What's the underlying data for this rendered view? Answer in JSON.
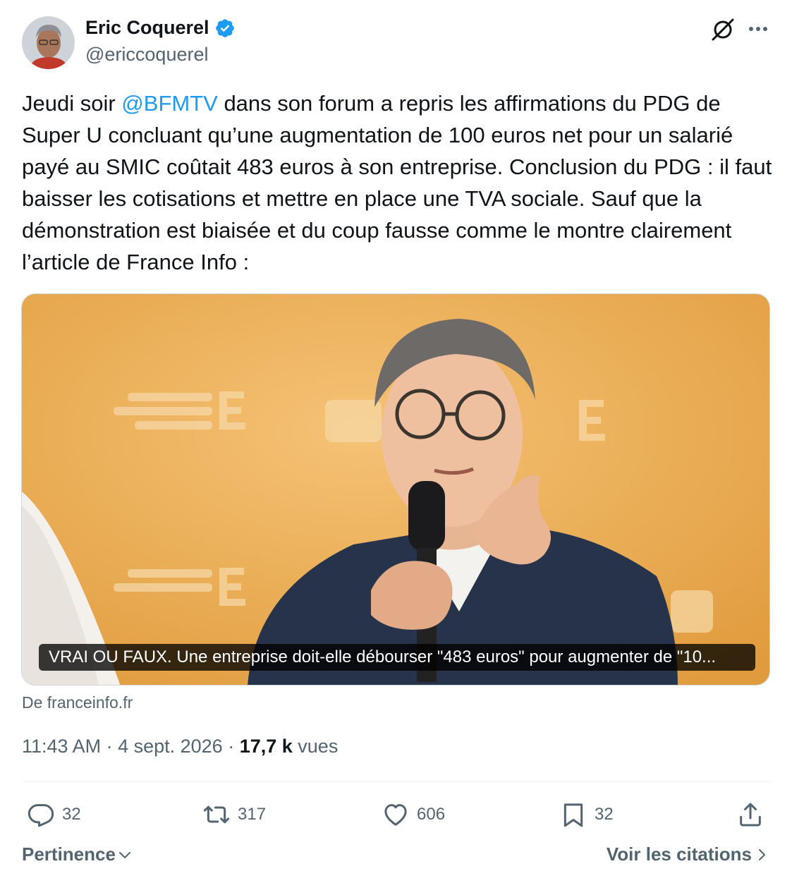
{
  "author": {
    "name": "Eric Coquerel",
    "handle": "@ericcoquerel",
    "verified_icon": "verified-badge-icon",
    "verified_color": "#1d9bf0"
  },
  "header_icons": [
    "grok-icon",
    "more-icon"
  ],
  "tweet": {
    "text_before": "Jeudi soir ",
    "mention": "@BFMTV",
    "text_after": " dans son forum a repris les affirmations du PDG de Super U concluant qu’une augmentation de 100 euros net pour un salarié payé au SMIC coûtait 483 euros à son entreprise. Conclusion du PDG : il faut baisser les cotisations et mettre en place une TVA sociale. Sauf que la démonstration est biaisée et du coup fausse comme le montre clairement l’article de France Info :"
  },
  "card": {
    "caption": "VRAI OU FAUX. Une entreprise doit-elle débourser \"483 euros\" pour augmenter de \"10...",
    "source": "De franceinfo.fr"
  },
  "meta": {
    "time": "11:43 AM",
    "separator": " · ",
    "date": "4 sept. 2026",
    "views_count": "17,7 k",
    "views_label": " vues"
  },
  "actions": {
    "replies": "32",
    "reposts": "317",
    "likes": "606",
    "bookmarks": "32"
  },
  "footer": {
    "sort_label": "Pertinence",
    "quotes_label": "Voir les citations"
  },
  "colors": {
    "text": "#0f1419",
    "secondary": "#536471",
    "link": "#1d9bf0",
    "card_background": "#eaa84a"
  }
}
